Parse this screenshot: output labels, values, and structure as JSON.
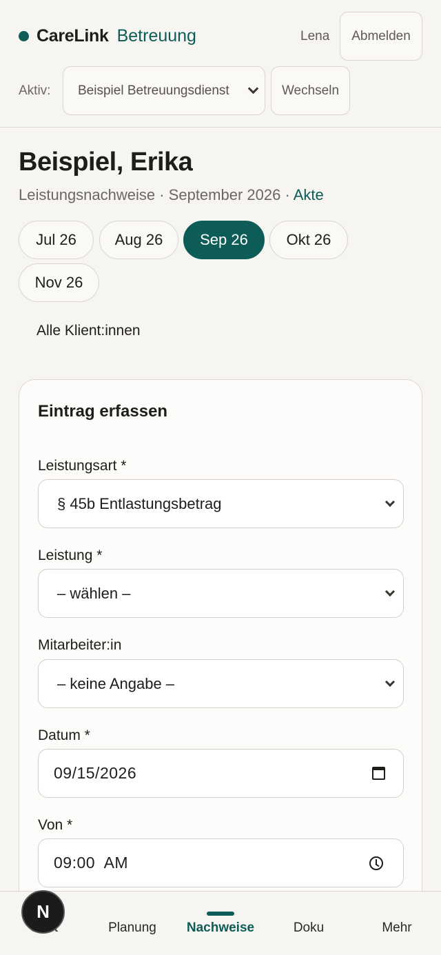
{
  "header": {
    "brand_name": "CareLink",
    "brand_sub": "Betreuung",
    "user_name": "Lena",
    "logout_label": "Abmelden",
    "active_label": "Aktiv:",
    "service_value": "Beispiel Betreuungsdienst",
    "switch_label": "Wechseln"
  },
  "client": {
    "name": "Beispiel, Erika",
    "subtitle": "Leistungsnachweise · September 2026 · ",
    "akte_link": "Akte"
  },
  "months": [
    {
      "label": "Jul 26",
      "active": false
    },
    {
      "label": "Aug 26",
      "active": false
    },
    {
      "label": "Sep 26",
      "active": true
    },
    {
      "label": "Okt 26",
      "active": false
    },
    {
      "label": "Nov 26",
      "active": false
    }
  ],
  "back_link": "Alle Klient:innen",
  "form": {
    "title": "Eintrag erfassen",
    "leistungsart_label": "Leistungsart *",
    "leistungsart_value": "§ 45b Entlastungsbetrag",
    "leistung_label": "Leistung *",
    "leistung_value": "– wählen –",
    "mitarbeiter_label": "Mitarbeiter:in",
    "mitarbeiter_value": "– keine Angabe –",
    "datum_label": "Datum *",
    "datum_value": "09/15/2026",
    "von_label": "Von *",
    "von_value": "09:00  AM"
  },
  "nav": {
    "badge": "N",
    "items": [
      "Start",
      "Planung",
      "Nachweise",
      "Doku",
      "Mehr"
    ],
    "active": "Nachweise"
  },
  "colors": {
    "accent": "#0d5c57",
    "background": "#f6f5f1"
  }
}
